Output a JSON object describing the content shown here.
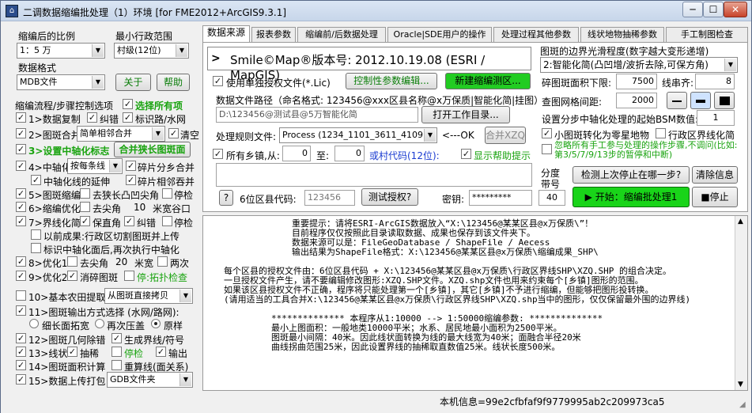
{
  "window": {
    "title": "二调数据缩编批处理（1）环境 [for FME2012+ArcGIS9.3.1]",
    "min": "─",
    "max": "☐",
    "close": "✕"
  },
  "left": {
    "scale_label": "缩编后的比例",
    "scale_value": "1：5 万",
    "admin_label": "最小行政范围",
    "admin_value": "村级(12位)",
    "format_label": "数据格式",
    "format_value": "MDB文件",
    "about_btn": "关于",
    "help_btn": "帮助",
    "steps_label": "缩编流程/步骤控制选项",
    "select_all": "选择所有项",
    "s1": "1>数据复制",
    "s1b": "纠错",
    "s1c": "标识路/水网",
    "s2": "2>图斑合并",
    "s2sel": "简单相邻合并",
    "s2b": "清空",
    "s3": "3>设置中轴化标志",
    "s3btn": "合并狭长图斑面",
    "s4": "4>中轴化",
    "s4sel": "按每条线",
    "s4b": "碎片分乡合并",
    "s4c": "中轴化线的延伸",
    "s4d": "碎片相邻吞并",
    "s5": "5>图斑缩编",
    "s5b": "去狭长凸凹尖角",
    "s5c": "停检",
    "s6": "6>缩编优化",
    "s6b": "去尖角",
    "s6v": "10",
    "s6c": "米宽谷口",
    "s7": "7>界线化简",
    "s7b": "保直角",
    "s7c": "纠错",
    "s7d": "停检",
    "s7e": "以前成果:行政区切割图斑并上传",
    "s7f": "标识中轴化面后,再次执行中轴化",
    "s8": "8>优化1",
    "s8b": "去尖角",
    "s8v": "20",
    "s8c": "米宽",
    "s8d": "两次",
    "s9": "9>优化2",
    "s9b": "消碎图斑",
    "s9c": "停:拓扑检查",
    "s10": "10>基本农田提取",
    "s10sel": "从图斑直接拷贝",
    "s11": "11>图斑输出方式选择 (水网/路网):",
    "r1": "细长面拓宽",
    "r2": "再次压盖",
    "r3": "原样",
    "s12": "12>图斑几何除错",
    "s12b": "生成界线/符号",
    "s13": "13>线状",
    "s13b": "抽稀",
    "s13c": "停检",
    "s13d": "输出",
    "s14": "14>图斑面积计算",
    "s14b": "重算线(面关系)",
    "s15": "15>数据上传打包",
    "s15sel": "GDB文件夹"
  },
  "tabs": [
    "数据来源",
    "报表参数",
    "缩编前/后数据处理",
    "Oracle|SDE用户的操作",
    "处理过程其他参数",
    "线状地物抽稀参数",
    "手工制图检查"
  ],
  "panel": {
    "version": "Smile©Map®版本号: 2012.10.19.08 (ESRI / MapGIS)",
    "border_label": "图斑的边界光滑程度(数字越大变形递增)",
    "border_value": "2:智能化简(凸凹增/波折去除,可保方角)",
    "single_license": "使用单独授权文件(*.Lic)",
    "ctrl_btn": "控制性参数编辑...",
    "new_region": "新建缩编测区...",
    "min_area_label": "碎图斑面积下限:",
    "min_area": "7500",
    "line_align_label": "线串齐:",
    "line_align": "8",
    "grid_label": "查图网格间距:",
    "grid": "2000",
    "path_label": "数据文件路径（命名格式: 123456@xxx区县名称@x万保质|智能化简|挂图）",
    "path_value": "D:\\123456@测试县@5万智能化简",
    "open_btn": "打开工作目录...",
    "bsm_label": "设置分步中轴化处理的起始BSM数值:",
    "bsm": "1",
    "rule_label": "处理规则文件:",
    "rule_value": "Process (1234_1101_3611_4109)",
    "rule_ok": "<---OK",
    "merge_btn": "合并XZQ",
    "opt_small": "小图斑转化为零星地物",
    "opt_admin": "行政区界线化简",
    "all_towns": "所有乡镇,从:",
    "from": "0",
    "to_label": "至:",
    "to": "0",
    "village": "或村代码(12位):",
    "show_help": "显示帮助提示",
    "ignore_note": "忽略所有手工参与处理的操作步骤,不调问(比如:第3/5/7/9/13步的暂停和中断)",
    "q_btn": "?",
    "county_label": "6位区县代码:",
    "county": "123456",
    "test_btn": "测试授权?",
    "pwd_label": "密钥:",
    "pwd": "*********",
    "zone_label": "分度带号",
    "zone": "40",
    "check_btn": "检测上次停止在哪一步?",
    "clear_btn": "清除信息",
    "start_btn": "▶ 开始：缩编批处理1",
    "stop_btn": "■停止"
  },
  "info": [
    "重要提示：请将ESRI-ArcGIS数据放入“X:\\123456@某某区县@x万保质\\”！",
    "目前程序仅仅按照此目录读取数据、成果也保存到该文件夹下。",
    "数据来源可以是：FileGeoDatabase / ShapeFile / Aecess",
    "输出结果为ShapeFile格式：X:\\123456@某某区县@x万保质\\缩编成果_SHP\\",
    "",
    "每个区县的授权文件由：6位区县代码 + X:\\123456@某某区县@x万保质\\行政区界线SHP\\XZQ.SHP 的组合决定。",
    "一旦授权文件产生，请不要编辑修改图形:XZQ.SHP文件。XZQ.shp文件也用来约束每个[乡镇]图形的范围。",
    "如果该区县授权文件不正确，程序将只能处理第一个[乡镇]，其它[乡镇]不予进行缩编，但能够把图形投转换。",
    "(请用适当的工具合并X:\\123456@某某区县@x万保质\\行政区界线SHP\\XZQ.shp当中的图形，仅仅保留最外围的边界线)",
    "",
    "************** 本程序从1:10000 --> 1:50000缩编参数: **************",
    "最小上图面积：一般地类10000平米；水系、居民地最小面积为2500平米。",
    "图斑最小间隔：40米。因此线状面转换为线的最大线宽为40米；面融合半径20米",
    "曲线拐曲范围25米，因此设置界线的抽稀取直数值25米。线状长度500米。"
  ],
  "status": {
    "machine": "本机信息=99e2cfbfaf9f9779995ab2c209973ca5"
  }
}
